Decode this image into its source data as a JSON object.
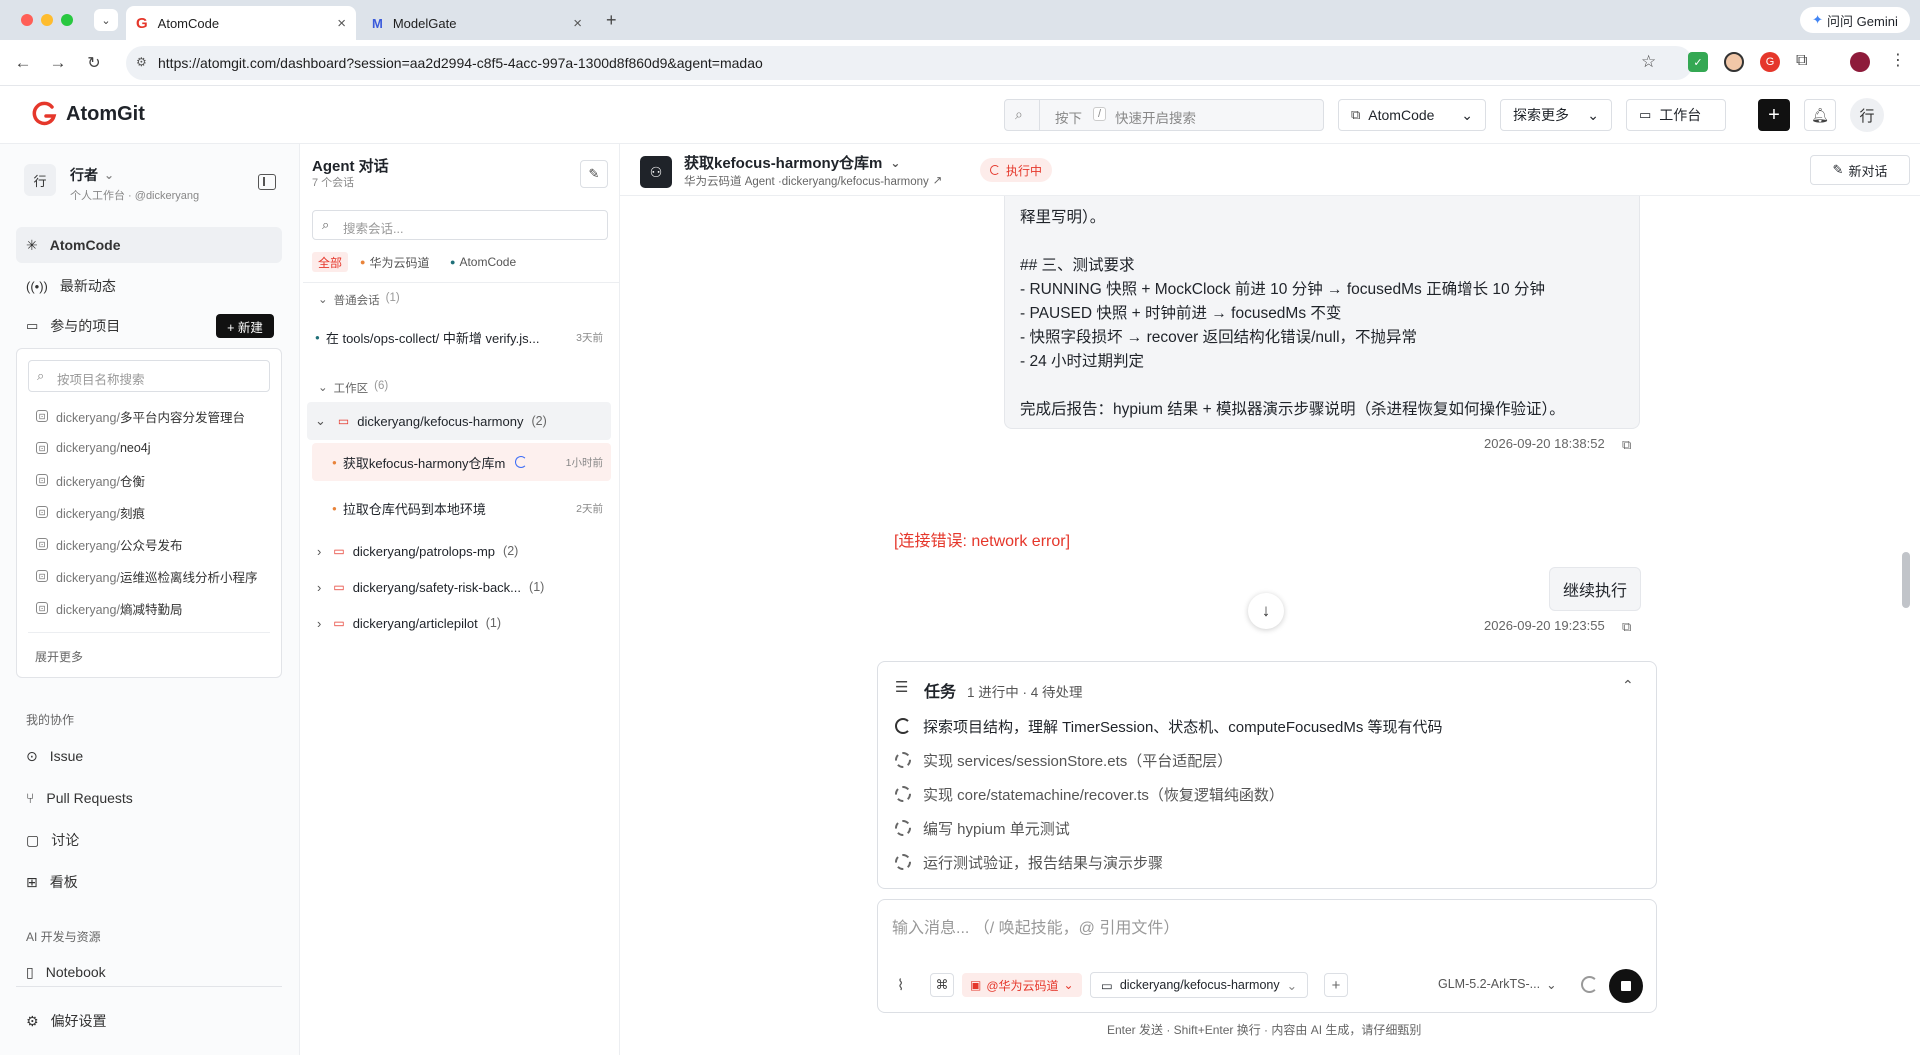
{
  "browser": {
    "tabs": [
      {
        "title": "AtomCode",
        "active": true
      },
      {
        "title": "ModelGate",
        "active": false
      }
    ],
    "url": "https://atomgit.com/dashboard?session=aa2d2994-c8f5-4acc-997a-1300d8f860d9&agent=madao",
    "gemini_label": "问问 Gemini"
  },
  "header": {
    "logo_text": "AtomGit",
    "search_prefix": "按下",
    "search_key": "/",
    "search_placeholder": "快速开启搜索",
    "atomcode_label": "AtomCode",
    "explore_label": "探索更多",
    "workbench_label": "工作台",
    "avatar_text": "行",
    "brand_color": "#e5372b"
  },
  "sidebar": {
    "user_avatar": "行",
    "user_name": "行者",
    "user_sub": "个人工作台 · @dickeryang",
    "nav": [
      {
        "label": "AtomCode",
        "icon": "sparkle-icon",
        "active": true
      },
      {
        "label": "最新动态",
        "icon": "broadcast-icon",
        "active": false
      },
      {
        "label": "参与的项目",
        "icon": "folder-icon",
        "active": false
      }
    ],
    "new_button": "+ 新建",
    "project_search_placeholder": "按项目名称搜索",
    "projects": [
      {
        "owner": "dickeryang/",
        "name": "多平台内容分发管理台"
      },
      {
        "owner": "dickeryang/",
        "name": "neo4j"
      },
      {
        "owner": "dickeryang/",
        "name": "仓衡"
      },
      {
        "owner": "dickeryang/",
        "name": "刻痕"
      },
      {
        "owner": "dickeryang/",
        "name": "公众号发布"
      },
      {
        "owner": "dickeryang/",
        "name": "运维巡检离线分析小程序"
      },
      {
        "owner": "dickeryang/",
        "name": "熵减特勤局"
      }
    ],
    "expand_more": "展开更多",
    "collab_title": "我的协作",
    "collab_items": [
      {
        "label": "Issue",
        "icon": "issue-icon"
      },
      {
        "label": "Pull Requests",
        "icon": "pull-request-icon"
      },
      {
        "label": "讨论",
        "icon": "chat-icon"
      },
      {
        "label": "看板",
        "icon": "board-icon"
      }
    ],
    "ai_title": "AI 开发与资源",
    "ai_items": [
      {
        "label": "Notebook",
        "icon": "notebook-icon"
      }
    ],
    "settings_label": "偏好设置"
  },
  "conversations": {
    "title": "Agent 对话",
    "count": "7 个会话",
    "search_placeholder": "搜索会话...",
    "filters": [
      "全部",
      "华为云码道",
      "AtomCode"
    ],
    "general_section": "普通会话",
    "general_count": "(1)",
    "general_items": [
      {
        "title": "在 tools/ops-collect/ 中新增 verify.js...",
        "time": "3天前"
      }
    ],
    "workspace_section": "工作区",
    "workspace_count": "(6)",
    "workspaces": [
      {
        "name": "dickeryang/kefocus-harmony",
        "count": "(2)",
        "expanded": true,
        "items": [
          {
            "title": "获取kefocus-harmony仓库m",
            "time": "1小时前",
            "running": true
          },
          {
            "title": "拉取仓库代码到本地环境",
            "time": "2天前",
            "running": false
          }
        ]
      },
      {
        "name": "dickeryang/patrolops-mp",
        "count": "(2)",
        "expanded": false
      },
      {
        "name": "dickeryang/safety-risk-back...",
        "count": "(1)",
        "expanded": false
      },
      {
        "name": "dickeryang/articlepilot",
        "count": "(1)",
        "expanded": false
      }
    ]
  },
  "chat": {
    "title": "获取kefocus-harmony仓库m",
    "subtitle": "华为云码道 Agent ·dickeryang/kefocus-harmony",
    "status": "执行中",
    "new_chat": "新对话",
    "message_lines": [
      "释里写明）。",
      "",
      "## 三、测试要求",
      "- RUNNING 快照 + MockClock 前进 10 分钟 → focusedMs 正确增长 10 分钟",
      "- PAUSED 快照 + 时钟前进 → focusedMs 不变",
      "- 快照字段损坏 → recover 返回结构化错误/null，不抛异常",
      "- 24 小时过期判定",
      "",
      "完成后报告：hypium 结果 + 模拟器演示步骤说明（杀进程恢复如何操作验证）。"
    ],
    "message_time": "2026-09-20 18:38:52",
    "error_text": "[连接错误: network error]",
    "reply_text": "继续执行",
    "reply_time": "2026-09-20 19:23:55",
    "tasks_title": "任务",
    "tasks_summary": "1 进行中 · 4 待处理",
    "tasks": [
      {
        "label": "探索项目结构，理解 TimerSession、状态机、computeFocusedMs 等现有代码",
        "state": "in_progress"
      },
      {
        "label": "实现 services/sessionStore.ets（平台适配层）",
        "state": "pending"
      },
      {
        "label": "实现 core/statemachine/recover.ts（恢复逻辑纯函数）",
        "state": "pending"
      },
      {
        "label": "编写 hypium 单元测试",
        "state": "pending"
      },
      {
        "label": "运行测试验证，报告结果与演示步骤",
        "state": "pending"
      }
    ],
    "input_placeholder": "输入消息...  （/ 唤起技能，@ 引用文件）",
    "agent_chip": "@华为云码道",
    "repo_chip": "dickeryang/kefocus-harmony",
    "model_chip": "GLM-5.2-ArkTS-...",
    "footer_note": "Enter 发送 · Shift+Enter 换行 · 内容由 AI 生成，请仔细甄别"
  }
}
